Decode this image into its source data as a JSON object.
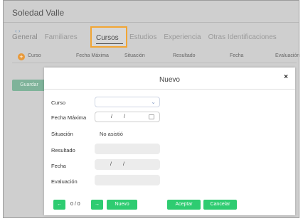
{
  "app": {
    "title": "Soledad Valle"
  },
  "tabs": {
    "items": [
      "General",
      "Familiares",
      "Cursos",
      "Estudios",
      "Experiencia",
      "Otras Identificaciones"
    ],
    "active": "Cursos"
  },
  "grid": {
    "headers": [
      "Curso",
      "Fecha Máxima",
      "Situación",
      "Resultado",
      "Fecha",
      "Evaluación"
    ],
    "add_icon": "plus-icon"
  },
  "background": {
    "save_label": "Guardar"
  },
  "modal": {
    "title": "Nuevo",
    "close_label": "×",
    "fields": {
      "curso": {
        "label": "Curso",
        "value": ""
      },
      "fecha_maxima": {
        "label": "Fecha Máxima",
        "day": "",
        "month": "",
        "year": ""
      },
      "situacion": {
        "label": "Situación",
        "value": "No asistió"
      },
      "resultado": {
        "label": "Resultado",
        "value": ""
      },
      "fecha": {
        "label": "Fecha",
        "value": ""
      },
      "evaluacion": {
        "label": "Evaluación",
        "value": ""
      }
    },
    "date_separator": "/",
    "pager": {
      "prev_label": "←",
      "next_label": "→",
      "counter": "0 / 0"
    },
    "buttons": {
      "new": "Nuevo",
      "accept": "Aceptar",
      "cancel": "Cancelar"
    }
  },
  "colors": {
    "accent_green": "#2ecc71",
    "tab_highlight": "#f2a533",
    "add_icon": "#e89a3b"
  }
}
